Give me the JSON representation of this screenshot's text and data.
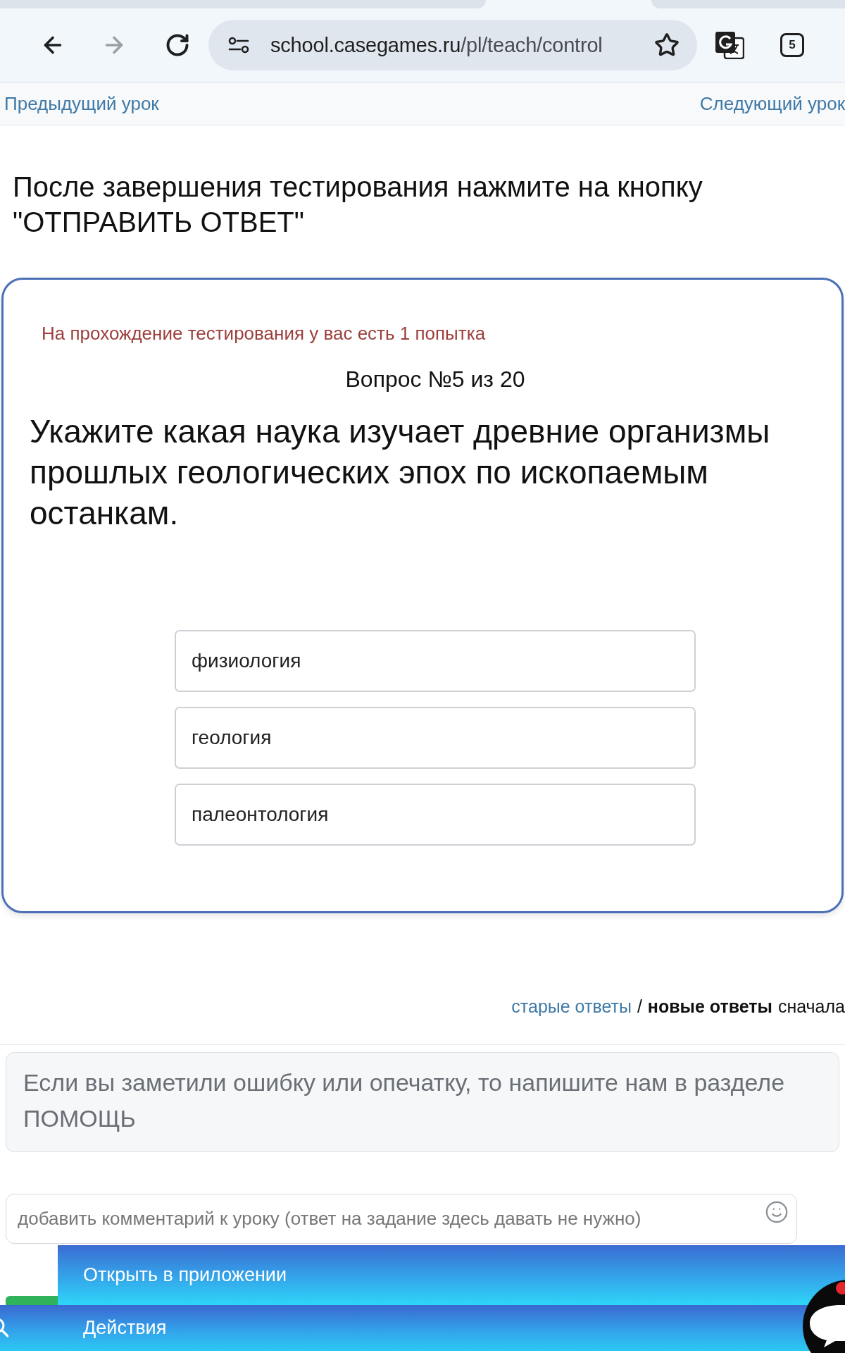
{
  "browser": {
    "url_host": "school.casegames.ru",
    "url_path": "/pl/teach/control",
    "forward_disabled": true,
    "tab_count": "5"
  },
  "lesson_nav": {
    "previous": "Предыдущий урок",
    "next": "Следующий урок"
  },
  "instruction": "После завершения тестирования нажмите на кнопку \"ОТПРАВИТЬ ОТВЕТ\"",
  "quiz": {
    "attempts_note": "На прохождение тестирования у вас есть 1 попытка",
    "question_number": "Вопрос №5 из 20",
    "question": "Укажите какая наука изучает древние организмы прошлых геологических эпох по ископаемым останкам.",
    "options": [
      {
        "label": "физиология",
        "selected": false
      },
      {
        "label": "геология",
        "selected": false
      },
      {
        "label": "палеонтология",
        "selected": false
      }
    ]
  },
  "answer_sort": {
    "options": [
      {
        "label": "старые ответы",
        "selected": false
      },
      {
        "label": "новые ответы",
        "selected": true
      }
    ],
    "separator": "/",
    "suffix": "сначала"
  },
  "help_notice": "Если вы заметили ошибку или опечатку, то напишите нам в разделе ПОМОЩЬ",
  "comment_field": {
    "placeholder": "добавить комментарий к уроку (ответ на задание здесь давать не нужно)"
  },
  "app_banner": {
    "label": "Открыть в приложении"
  },
  "actions_bar": {
    "label": "Действия"
  }
}
